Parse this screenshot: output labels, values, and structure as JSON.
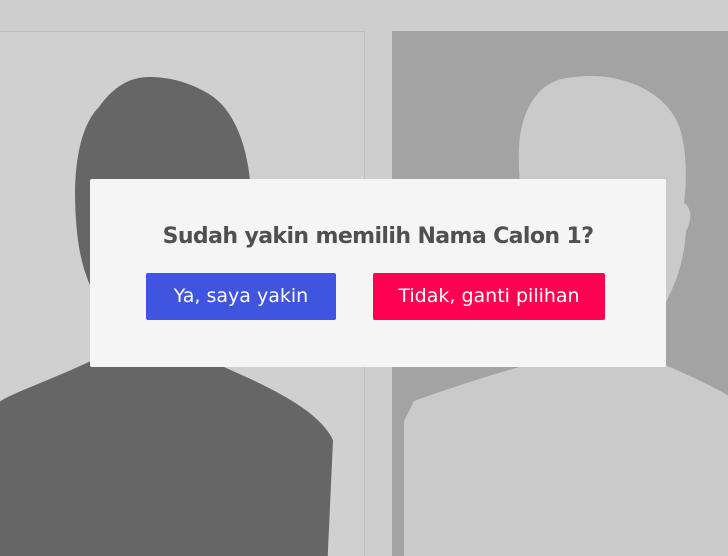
{
  "dialog": {
    "title": "Sudah yakin memilih Nama Calon 1?",
    "confirm_label": "Ya, saya yakin",
    "cancel_label": "Tidak, ganti pilihan"
  },
  "candidates": [
    {
      "photo": "avatar-placeholder",
      "selected": true
    },
    {
      "photo": "avatar-placeholder",
      "selected": false
    }
  ],
  "colors": {
    "background": "#cdcecd",
    "confirm_button": "#3f55e0",
    "cancel_button": "#ff0052",
    "dialog_bg": "#f5f5f5",
    "title_text": "#505050",
    "silhouette_dark": "#666666",
    "silhouette_light": "#c9cac9"
  }
}
